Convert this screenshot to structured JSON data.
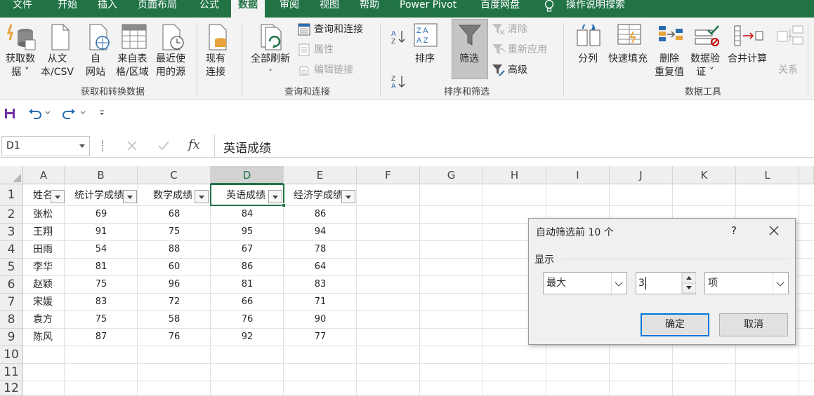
{
  "tabs": [
    "文件",
    "开始",
    "插入",
    "页面布局",
    "公式",
    "数据",
    "审阅",
    "视图",
    "帮助",
    "Power Pivot",
    "百度网盘",
    "操作说明搜索"
  ],
  "active_tab": "数据",
  "ribbon": {
    "get_data": [
      "获取数",
      "据 ˅"
    ],
    "from_csv": [
      "从文",
      "本/CSV"
    ],
    "from_web": [
      "自",
      "网站"
    ],
    "from_table": [
      "来自表",
      "格/区域"
    ],
    "recent_sources": [
      "最近使",
      "用的源"
    ],
    "existing": [
      "现有",
      "连接"
    ],
    "group1": "获取和转换数据",
    "refresh_all": [
      "全部刷新",
      "˅"
    ],
    "queries_connections": "查询和连接",
    "properties": "属性",
    "edit_links": "编辑链接",
    "group2": "查询和连接",
    "sort": "排序",
    "filter": "筛选",
    "clear": "清除",
    "reapply": "重新应用",
    "advanced": "高级",
    "group3": "排序和筛选",
    "text_to_columns": "分列",
    "flash_fill": "快速填充",
    "remove_dup": [
      "删除",
      "重复值"
    ],
    "data_validation": [
      "数据验",
      "证 ˅"
    ],
    "consolidate": "合并计算",
    "relationships": "关系",
    "group4": "数据工具"
  },
  "formula_bar": {
    "name_box": "D1",
    "formula": "英语成绩"
  },
  "columns": [
    "A",
    "B",
    "C",
    "D",
    "E",
    "F",
    "G",
    "H",
    "I",
    "J",
    "K",
    "L"
  ],
  "selected_column": "D",
  "rows": [
    "1",
    "2",
    "3",
    "4",
    "5",
    "6",
    "7",
    "8",
    "9",
    "10",
    "11",
    "12"
  ],
  "headers": [
    "姓名",
    "统计学成绩",
    "数学成绩",
    "英语成绩",
    "经济学成绩"
  ],
  "table": [
    [
      "张松",
      "69",
      "68",
      "84",
      "86"
    ],
    [
      "王翔",
      "91",
      "75",
      "95",
      "94"
    ],
    [
      "田雨",
      "54",
      "88",
      "67",
      "78"
    ],
    [
      "李华",
      "81",
      "60",
      "86",
      "64"
    ],
    [
      "赵颖",
      "75",
      "96",
      "81",
      "83"
    ],
    [
      "宋媛",
      "83",
      "72",
      "66",
      "71"
    ],
    [
      "袁方",
      "75",
      "58",
      "76",
      "90"
    ],
    [
      "陈风",
      "87",
      "76",
      "92",
      "77"
    ]
  ],
  "dialog": {
    "title": "自动筛选前 10 个",
    "help": "?",
    "section": "显示",
    "mode": "最大",
    "count": "3",
    "unit": "项",
    "ok": "确定",
    "cancel": "取消"
  }
}
